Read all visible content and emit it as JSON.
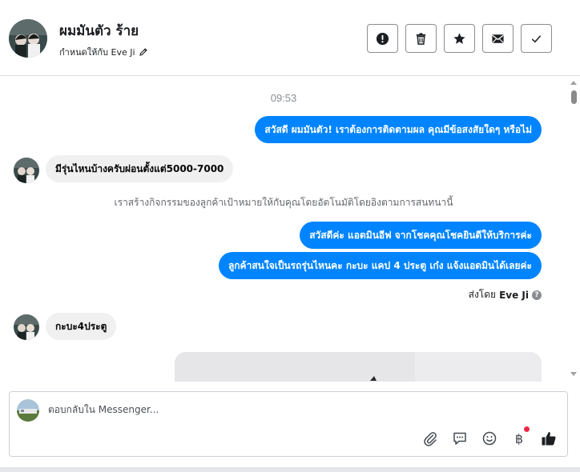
{
  "header": {
    "name": "ผมมันตัว ร้าย",
    "assign_label": "กำหนดให้กับ Eve Ji",
    "actions": [
      {
        "icon": "alert-icon"
      },
      {
        "icon": "trash-icon"
      },
      {
        "icon": "star-icon"
      },
      {
        "icon": "envelope-icon"
      },
      {
        "icon": "check-icon"
      }
    ]
  },
  "thread": {
    "timestamp": "09:53",
    "messages": [
      {
        "direction": "out",
        "text": "สวัสดี ผมมันตัว! เราต้องการติดตามผล คุณมีข้อสงสัยใดๆ หรือไม่"
      },
      {
        "direction": "in",
        "text": "มีรุ่นไหนบ้างครับผ่อนตั้งแต่5000-7000"
      },
      {
        "direction": "out",
        "text": "สวัสดีค่ะ แอดมินอีฟ จากโชคคุณโชคยินดีให้บริการค่ะ"
      },
      {
        "direction": "out",
        "text": "ลูกค้าสนใจเป็นรถรุ่นไหนคะ กะบะ แคป 4  ประตู เก๋ง แจ้งแอดมินได้เลยค่ะ"
      },
      {
        "direction": "in",
        "text": "กะบะ4ประตู"
      }
    ],
    "system_note": "เราสร้างกิจกรรมของลูกค้าเป้าหมายให้กับคุณโดยอัตโนมัติโดยอิงตามการสนทนานี้",
    "sent_by_prefix": "ส่งโดย",
    "sent_by_name": "Eve Ji",
    "help_icon_glyph": "?"
  },
  "composer": {
    "placeholder": "ตอบกลับใน Messenger...",
    "tools": [
      "paperclip-icon",
      "chat-bubble-icon",
      "emoji-icon",
      "baht-icon",
      "thumbs-up-icon"
    ],
    "baht_glyph": "฿"
  },
  "colors": {
    "accent": "#0084ff",
    "incoming_bubble": "#f0f0f0",
    "notification_dot": "#f02849"
  }
}
